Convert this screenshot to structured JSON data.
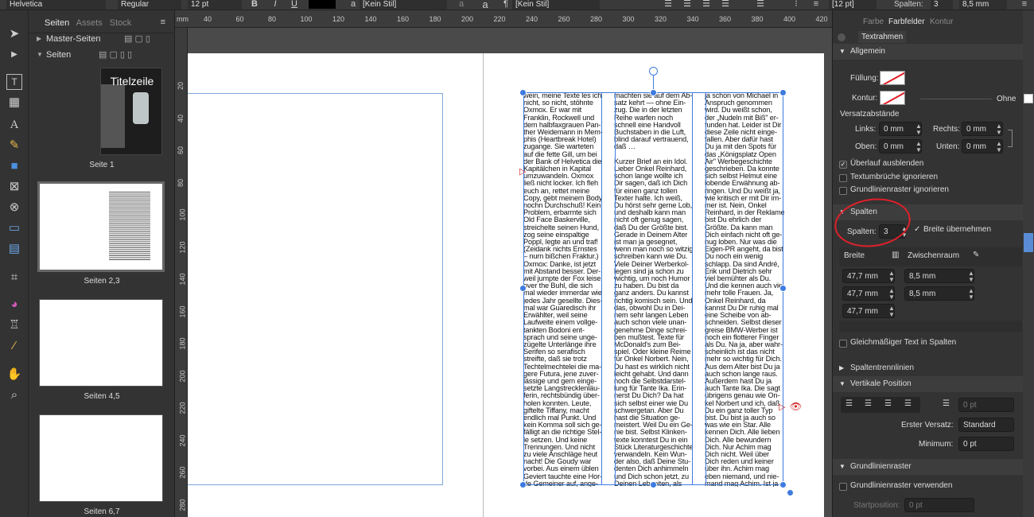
{
  "toolbar": {
    "font": "Helvetica",
    "style": "Regular",
    "size": "12 pt",
    "bold": "B",
    "italic": "I",
    "underline": "U",
    "char_style": "[Kein Stil]",
    "para_style": "[Kein Stil]",
    "leading": "[12 pt]",
    "columns_label": "Spalten:",
    "columns_value": "3",
    "gutter_value": "8,5 mm"
  },
  "pages_panel": {
    "tabs": [
      "Seiten",
      "Assets",
      "Stock"
    ],
    "master_label": "Master-Seiten",
    "pages_label": "Seiten",
    "thumb1_title": "Titelzeile",
    "captions": [
      "Seite 1",
      "Seiten 2,3",
      "Seiten 4,5",
      "Seiten 6,7"
    ]
  },
  "ruler": {
    "h": [
      "mm",
      "40",
      "60",
      "80",
      "100",
      "120",
      "140",
      "160",
      "180",
      "200",
      "220",
      "240",
      "260",
      "280",
      "300",
      "320",
      "340",
      "360",
      "380",
      "400",
      "420"
    ],
    "v": [
      "20",
      "40",
      "60",
      "80",
      "100",
      "120",
      "140",
      "160",
      "180",
      "200",
      "220",
      "240",
      "260",
      "280"
    ]
  },
  "document": {
    "col1": "wein, meine Texte les ich\nnicht, so nicht, stöhnte\nOxmox. Er war mit\nFranklin, Rockwell und\ndem halbfaxgrauen Pan-\nther Weidemann in Mem-\nphis (Heartbreak Hotel)\nzugange. Sie warteten\nauf die fette Gill, um bei\nder Bank of Helvetica die\nKapitälchen in Kapital\numzuwandeln. Oxmox\nließ nicht locker. Ich fleh\neuch an, rettet meine\nCopy, gebt meinem Body\nnochn Durchschuß! Kein\nProblem, erbarmte sich\nOld Face Baskerville,\nstreichelte seinen Hund,\nzog seine einspaltige\nPoppl, legte an und traf!\n(Zeidank nichts Ernstes\n– nurn bißchen Fraktur.)\nOxmox: Danke, ist jetzt\nmit Abstand besser. Der-\nweil jumpte der Fox leise\nover the Buhl, die sich\nmal wieder immerdar wie\njedes Jahr gesellte. Dies-\nmal war Guaredisch ihr\nErwählter, weil seine\nLaufweite einem vollge-\ntankten Bodoni ent-\nsprach und seine unge-\nzügelte Unterlänge ihre\nSerifen so serafisch\nstreifte, daß sie trotz\nTechtelmechtelei die ma-\ngere Futura, jene zuver-\nlässige und gern einge-\nsetzte Langstrecklenläu-\nferin, rechtsbündig über-\nholen konnten. Leute,\ngiftelte Tiffany, macht\nendlich mal Punkt. Und\nkein Komma soll sich ge-\nfälligt an die richtige Stel-\nle setzen. Und keine\nTrennungen. Und nicht\nzu viele Anschläge heut\nnacht! Die Goudy war\nvorbei. Aus einem üblen\nGeviert tauchte eine Hor-\nde Gemeiner auf, ange-\nführt von einem Versa-\nlen. Als sie des Grau-\nwerts anblickig wurden,",
    "col2": "machten sie auf dem Ab-\nsatz kehrt — ohne Ein-\nzug. Die in der letzten\nReihe warfen noch\nschnell eine Handvoll\nBuchstaben in die Luft,\nblind darauf vertrauend,\ndaß …\n\nKurzer Brief an ein Idol.\nLieber Onkel Reinhard,\nschon lange wollte ich\nDir sagen, daß ich Dich\nfür einen ganz tollen\nTexter halte. Ich weiß,\nDu hörst sehr gerne Lob,\nund deshalb kann man\nnicht oft genug sagen,\ndaß Du der Größte bist.\nGerade in Deinem Alter\nist man ja gesegnet,\nwenn man noch so witzig\nschreiben kann wie Du.\nViele Deiner Werberkol-\nlegen sind ja schon zu\nwichtig, um noch Humor\nzu haben. Du bist da\nganz anders. Du kannst\nrichtig komisch sein. Und\ndas, obwohl Du in Dei-\nnem sehr langen Leben\nauch schon viele unan-\ngenehme Dinge schrei-\nben mußtest. Texte für\nMcDonald's zum Bei-\nspiel. Oder kleine Reime\nfür Onkel Norbert. Nein,\nDu hast es wirklich nicht\nleicht gehabt. Und dann\nnoch die Selbstdarstel-\nlung für Tante Ika. Erin-\nnerst Du Dich? Da hat\nsich selbst einer wie Du\nschwergetan. Aber Du\nhast die Situation ge-\nmeistert. Weil Du ein Ge-\nnie bist. Selbst Klinken-\ntexte konntest Du in ein\nStück Literaturgeschichte\nverwandeln. Kein Wun-\nder also, daß Deine Stu-\ndenten Dich anhimmeln\nund Dich schon jetzt, zu\nDeinen Lebzeiten, als\nden neuen Papst der\ndeutschen Reklame fei-\nern. Obwohl dieser Titel",
    "col3": "ja schon von Michael in\nAnspruch genommen\nwird. Du weißt schon,\nder „Nudeln mit Biß\" er-\nfunden hat. Leider ist Dir\ndiese Zeile nicht einge-\nfallen. Aber dafür hast\nDu ja mit den Spots für\ndas „Königsplatz Open\nAir\" Werbegeschichte\ngeschrieben. Da konnte\nsich selbst Helmut eine\nlobende Erwähnung ab-\nringen. Und Du weißt ja,\nwie kritisch er mit Dir im-\nmer ist. Nein, Onkel\nReinhard, in der Reklame\nbist Du ehrlich der\nGrößte. Da kann man\nDich einfach nicht oft ge-\nnug loben. Nur was die\nEigen-PR angeht, da bist\nDu noch ein wenig\nschlapp. Da sind André,\nErik und Dietrich sehr\nviel bemühter als Du.\nUnd die kennen auch viel\nmehr tolle Frauen. Ja,\nOnkel Reinhard, da\nkannst Du Dir ruhig mal\neine Scheibe von ab-\nschneiden. Selbst dieser\ngreise BMW-Werber ist\nnoch ein flotterer Finger\nals Du. Na ja, aber wahr-\nscheinlich ist das nicht\nmehr so wichtig für Dich.\nAus dem Alter bist Du ja\nauch schon lange raus.\nAußerdem hast Du ja\nauch Tante Ika. Die sagt\nübrigens genau wie On-\nkel Norbert und ich, daß\nDu ein ganz toller Typ\nbist. Du bist ja auch so\nwas wie ein Star. Alle\nkennen Dich. Alle lieben\nDich. Alle bewundern\nDich. Nur Achim mag\nDich nicht. Weil über\nDich reden und keiner\nüber ihn. Achim mag\neben niemand, und nie-\nmand mag Achim. Ist ja\nauch egal. Onkel Rein-\nhard, was ich Dir eigent-\nlich sagen wollte: Bleib,"
  },
  "right_panel": {
    "tabs": [
      "Farbe",
      "Farbfelder",
      "Kontur"
    ],
    "subtab": "Textrahmen",
    "general": "Allgemein",
    "fill": "Füllung:",
    "stroke": "Kontur:",
    "stroke_value": "Ohne",
    "insets": "Versatzabstände",
    "left": "Links:",
    "left_v": "0 mm",
    "right": "Rechts:",
    "right_v": "0 mm",
    "top": "Oben:",
    "top_v": "0 mm",
    "bottom": "Unten:",
    "bottom_v": "0 mm",
    "overflow": "Überlauf ausblenden",
    "ignore_wrap": "Textumbrüche ignorieren",
    "ignore_baseline": "Grundlinienraster ignorieren",
    "columns": "Spalten",
    "columns_label": "Spalten:",
    "columns_value": "3",
    "apply_width": "Breite übernehmen",
    "width_header": "Breite",
    "gutter_header": "Zwischenraum",
    "col_widths": [
      "47,7 mm",
      "47,7 mm",
      "47,7 mm"
    ],
    "gutters": [
      "8,5 mm",
      "8,5 mm"
    ],
    "balance": "Gleichmäßiger Text in Spalten",
    "rules": "Spaltentrennlinien",
    "vpos": "Vertikale Position",
    "vpos_field": "0 pt",
    "first_offset": "Erster Versatz:",
    "first_offset_v": "Standard",
    "minimum": "Minimum:",
    "minimum_v": "0 pt",
    "baseline": "Grundlinienraster",
    "use_baseline": "Grundlinienraster verwenden",
    "startpos": "Startposition:",
    "startpos_v": "0 pt"
  },
  "colors": {
    "accent": "#3d7be0",
    "highlight_circle": "#e0202a"
  }
}
